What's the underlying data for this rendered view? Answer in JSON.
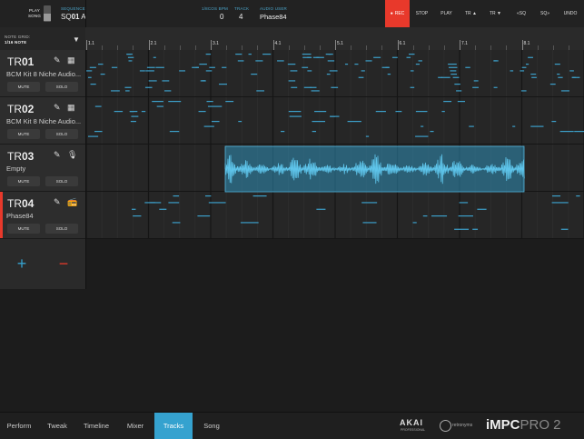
{
  "topbar": {
    "play_songs_label_1": "PLAY",
    "play_songs_label_2": "SONG",
    "sequence_caption": "SEQUENCE",
    "sequence_prefix": "SQ",
    "sequence_number": "01",
    "sequence_variant": "A",
    "bpm_caption": "1/8COS BPM",
    "bpm_value": "0",
    "track_caption": "TRACK",
    "track_value": "4",
    "audio_user_caption": "AUDIO USER",
    "audio_user_value": "Phase84",
    "rec_label": "REC",
    "stop_label": "STOP",
    "play_label": "PLAY",
    "tr_up_label": "TR ▲",
    "tr_down_label": "TR ▼",
    "sq_prev_label": "«SQ",
    "sq_next_label": "SQ»",
    "undo_label": "UNDO",
    "rec_color": "#e8392b"
  },
  "note_grid": {
    "caption": "NOTE GRID:",
    "value": "1/16 NOTE"
  },
  "ruler": {
    "marks": [
      "1.1",
      "2.1",
      "3.1",
      "4.1",
      "5.1",
      "6.1",
      "7.1",
      "8.1"
    ]
  },
  "tracks": [
    {
      "prefix": "TR",
      "num": "01",
      "name": "BCM Kit 8 Niche Audio...",
      "mute": "MUTE",
      "solo": "SOLO",
      "type_icon": "grid-icon",
      "active": false
    },
    {
      "prefix": "TR",
      "num": "02",
      "name": "BCM Kit 8 Niche Audio...",
      "mute": "MUTE",
      "solo": "SOLO",
      "type_icon": "grid-icon",
      "active": false
    },
    {
      "prefix": "TR",
      "num": "03",
      "name": "Empty",
      "mute": "MUTE",
      "solo": "SOLO",
      "type_icon": "microphone-icon",
      "active": false
    },
    {
      "prefix": "TR",
      "num": "04",
      "name": "Phase84",
      "mute": "MUTE",
      "solo": "SOLO",
      "type_icon": "speaker-icon",
      "active": true
    }
  ],
  "add_track_label": "+",
  "remove_track_label": "−",
  "bottom_tabs": [
    {
      "label": "Perform",
      "active": false
    },
    {
      "label": "Tweak",
      "active": false
    },
    {
      "label": "Timeline",
      "active": false
    },
    {
      "label": "Mixer",
      "active": false
    },
    {
      "label": "Tracks",
      "active": true
    },
    {
      "label": "Song",
      "active": false
    }
  ],
  "brand": {
    "akai": "AKAI",
    "akai_sub": "PROFESSIONAL",
    "retronyms": "retronyms",
    "impc_prefix": "iMPC",
    "impc_suffix": "PRO 2"
  },
  "colors": {
    "accent": "#35a2cf",
    "note": "#3c9fc9",
    "waveform": "#5ec4ea",
    "active_track": "#e8392b"
  }
}
